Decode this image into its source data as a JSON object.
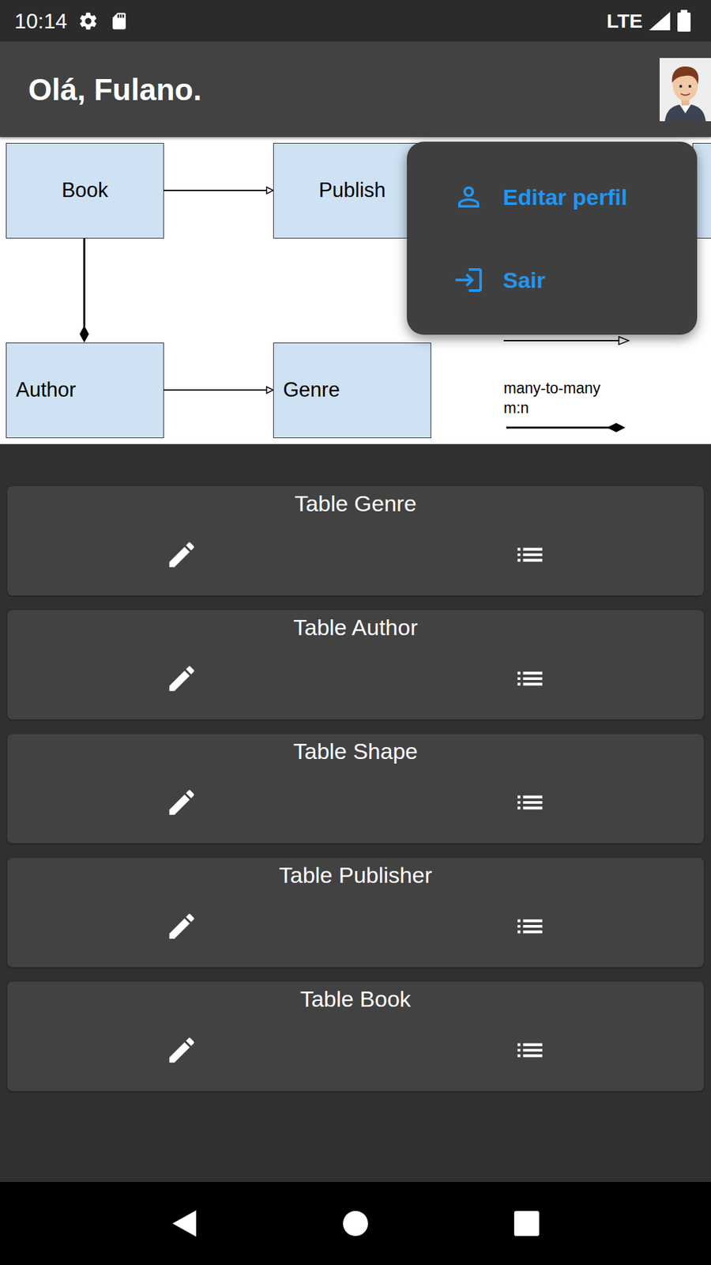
{
  "status_bar": {
    "time": "10:14",
    "network": "LTE",
    "signal_level": 1,
    "battery_level": 1
  },
  "app_bar": {
    "title": "Olá, Fulano."
  },
  "diagram": {
    "nodes": [
      {
        "label": "Book"
      },
      {
        "label": "Publish"
      },
      {
        "label": "Author"
      },
      {
        "label": "Genre"
      },
      {
        "label": ""
      }
    ],
    "legend": [
      "many-to-many",
      "m:n"
    ]
  },
  "menu": {
    "open": true,
    "items": [
      {
        "label": "Editar perfil",
        "kind": "profile"
      },
      {
        "label": "Sair",
        "kind": "logout"
      }
    ]
  },
  "cards": [
    {
      "title": "Table Genre"
    },
    {
      "title": "Table Author"
    },
    {
      "title": "Table Shape"
    },
    {
      "title": "Table Publisher"
    },
    {
      "title": "Table Book"
    }
  ]
}
